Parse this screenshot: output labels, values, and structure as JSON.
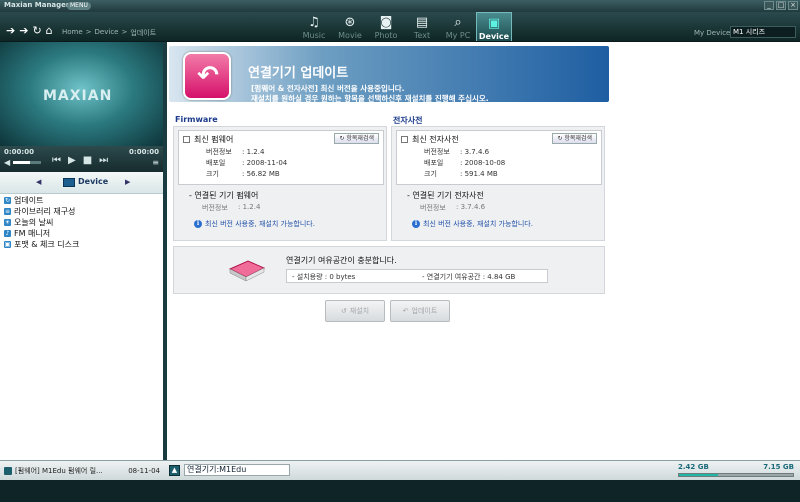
{
  "window": {
    "title": "Maxian Manager",
    "menu_label": "MENU",
    "controls": [
      "_",
      "□",
      "×"
    ]
  },
  "toolbar": {
    "nav_icons": [
      "back-arrow-icon",
      "forward-arrow-icon",
      "refresh-icon",
      "home-icon"
    ],
    "breadcrumb": [
      "Home",
      ">",
      "Device",
      ">",
      "업데이트"
    ],
    "tabs": [
      {
        "label": "Music",
        "icon": "music-note-icon",
        "glyph": "♫",
        "active": false
      },
      {
        "label": "Movie",
        "icon": "film-reel-icon",
        "glyph": "⊛",
        "active": false
      },
      {
        "label": "Photo",
        "icon": "camera-icon",
        "glyph": "◙",
        "active": false
      },
      {
        "label": "Text",
        "icon": "document-icon",
        "glyph": "▤",
        "active": false
      },
      {
        "label": "My PC",
        "icon": "computer-icon",
        "glyph": "⌕",
        "active": false
      },
      {
        "label": "Device",
        "icon": "device-icon",
        "glyph": "▣",
        "active": true
      }
    ],
    "mydevice_label": "My Device",
    "device_select": "M1 시리즈"
  },
  "player": {
    "logo": "MAXIAN",
    "time_current": "0:00:00",
    "time_total": "0:00:00",
    "volume_level": 0.6
  },
  "sidebar": {
    "device_label": "Device",
    "items": [
      {
        "label": "업데이트",
        "selected": true
      },
      {
        "label": "라이브러리 재구성",
        "selected": false
      },
      {
        "label": "오늘의 날씨",
        "selected": false
      },
      {
        "label": "FM 매니저",
        "selected": false
      },
      {
        "label": "포맷 & 체크 디스크",
        "selected": false
      }
    ]
  },
  "banner": {
    "title": "연결기기 업데이트",
    "line1": "[펌웨어 & 전자사전] 최신 버전을 사용중입니다.",
    "line2": "재설치를 원하실 경우 원하는 항목을 선택하신후 재설치를 진행해 주십시오."
  },
  "firmware": {
    "section_label": "Firmware",
    "card_title": "최신 펌웨어",
    "refresh_label": "항목재검색",
    "rows": [
      {
        "key": "버전정보",
        "value": ": 1.2.4"
      },
      {
        "key": "배포일",
        "value": ": 2008-11-04"
      },
      {
        "key": "크기",
        "value": ": 56.82 MB"
      }
    ],
    "connected_title": "- 연결된 기기 펌웨어",
    "connected_key": "버전정보",
    "connected_value": ": 1.2.4",
    "note": "최신 버전 사용중, 재설치 가능합니다."
  },
  "dictionary": {
    "section_label": "전자사전",
    "card_title": "최신 전자사전",
    "refresh_label": "항목재검색",
    "rows": [
      {
        "key": "버전정보",
        "value": ": 3.7.4.6"
      },
      {
        "key": "배포일",
        "value": ": 2008-10-08"
      },
      {
        "key": "크기",
        "value": ": 591.4 MB"
      }
    ],
    "connected_title": "- 연결된 기기 전자사전",
    "connected_key": "버전정보",
    "connected_value": ": 3.7.4.6",
    "note": "최신 버전 사용중, 재설치 가능합니다."
  },
  "space": {
    "title": "연결기기 여유공간이 충분합니다.",
    "used": "- 설치용량 : 0 bytes",
    "free": "- 연결기기 여유공간 : 4.84 GB"
  },
  "actions": {
    "reinstall_label": "재설치",
    "update_label": "업데이트"
  },
  "statusbar": {
    "left_text": "[펌웨어] M1Edu 펌웨어 릴...",
    "left_date": "08-11-04",
    "connection": "연결기기:M1Edu",
    "used_capacity": "2.42 GB",
    "total_capacity": "7.15 GB",
    "used_fraction": 0.34
  },
  "colors": {
    "accent": "#1e5ea2",
    "update_icon": "#d5106a",
    "capacity_fill": "#22b6a5"
  }
}
